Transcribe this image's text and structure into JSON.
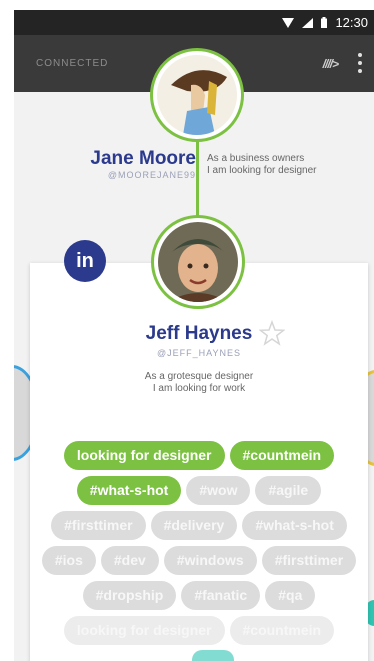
{
  "status_bar": {
    "time": "12:30"
  },
  "app_bar": {
    "title": "CONNECTED",
    "logo": "////>"
  },
  "top_profile": {
    "name": "Jane Moore",
    "handle": "@MOOREJANE99",
    "bio_line1": "As a business owners",
    "bio_line2": "I am looking for designer"
  },
  "card_profile": {
    "name": "Jeff Haynes",
    "handle": "@JEFF_HAYNES",
    "bio_line1": "As a grotesque designer",
    "bio_line2": "I am looking for work",
    "network": "in"
  },
  "tags": [
    {
      "label": "looking for designer",
      "selected": true
    },
    {
      "label": "#countmein",
      "selected": true
    },
    {
      "label": "#what-s-hot",
      "selected": true
    },
    {
      "label": "#wow",
      "selected": false
    },
    {
      "label": "#agile",
      "selected": false
    },
    {
      "label": "#firsttimer",
      "selected": false
    },
    {
      "label": "#delivery",
      "selected": false
    },
    {
      "label": "#what-s-hot",
      "selected": false
    },
    {
      "label": "#ios",
      "selected": false
    },
    {
      "label": "#dev",
      "selected": false
    },
    {
      "label": "#windows",
      "selected": false
    },
    {
      "label": "#firsttimer",
      "selected": false
    },
    {
      "label": "#dropship",
      "selected": false
    },
    {
      "label": "#fanatic",
      "selected": false
    },
    {
      "label": "#qa",
      "selected": false
    },
    {
      "label": "looking for designer",
      "selected": false,
      "faded": true
    },
    {
      "label": "#countmein",
      "selected": false,
      "faded": true
    }
  ],
  "colors": {
    "accent_green": "#7cc142",
    "name_blue": "#2b3a8c",
    "tag_inactive": "#dcdcdc",
    "appbar": "#3a3a3a",
    "statusbar": "#242424"
  }
}
